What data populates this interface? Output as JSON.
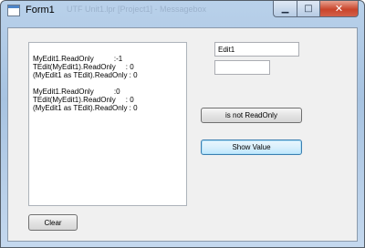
{
  "window": {
    "title": "Form1",
    "ghost_title": "UTF Unit1.lpr [Project1] - Messagebox",
    "minimize_glyph": "▁",
    "maximize_glyph": "□",
    "close_glyph": "✕"
  },
  "memo": {
    "lines": [
      "MyEdit1.ReadOnly          :-1",
      "TEdit(MyEdit1).ReadOnly     : 0",
      "(MyEdit1 as TEdit).ReadOnly : 0",
      "",
      "MyEdit1.ReadOnly          :0",
      "TEdit(MyEdit1).ReadOnly     : 0",
      "(MyEdit1 as TEdit).ReadOnly : 0"
    ]
  },
  "edit1": {
    "value": "Edit1"
  },
  "edit2": {
    "value": ""
  },
  "buttons": {
    "readonly_label": "is not ReadOnly",
    "show_value_label": "Show Value",
    "clear_label": "Clear"
  }
}
